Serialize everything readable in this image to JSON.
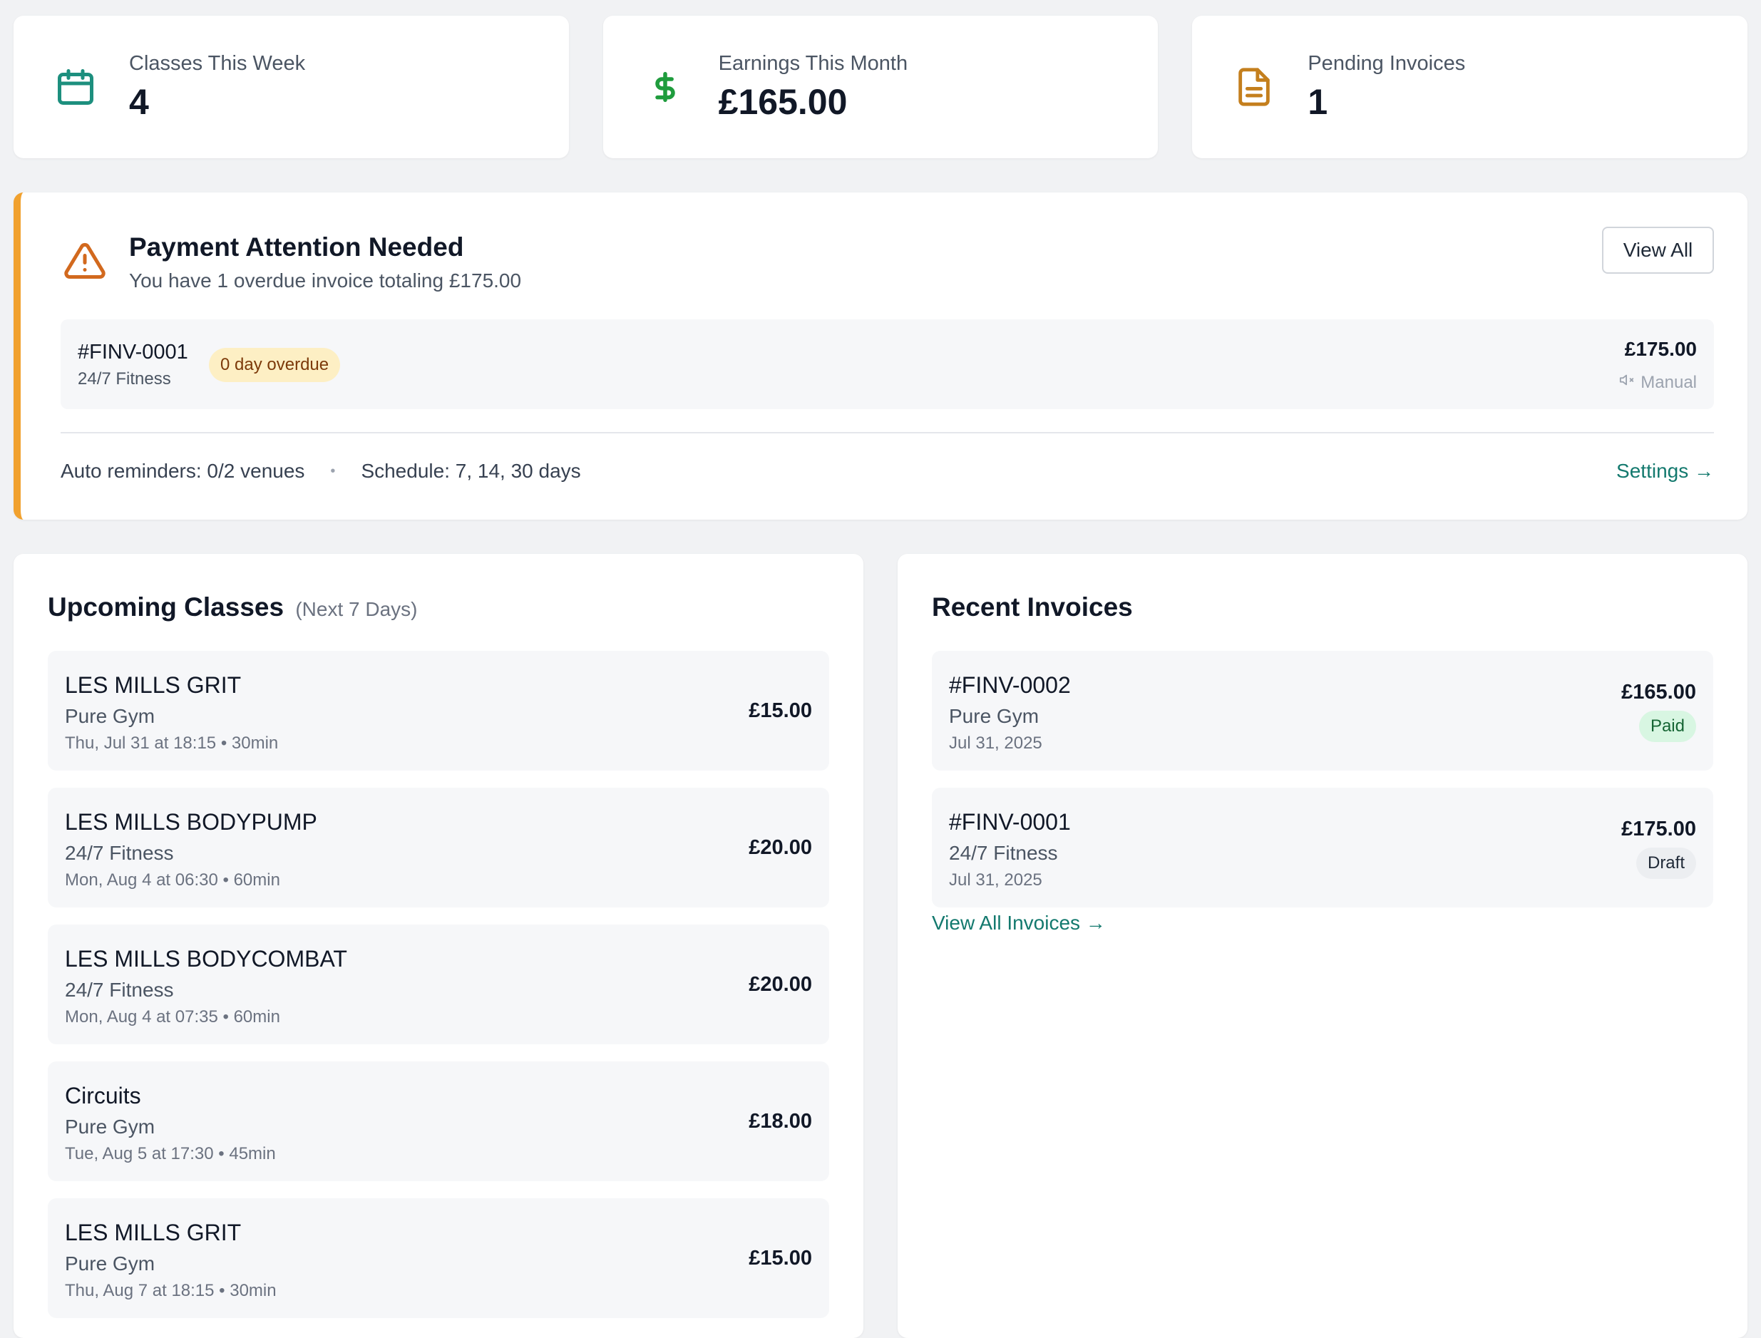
{
  "stats": [
    {
      "label": "Classes This Week",
      "value": "4",
      "icon": "calendar-icon",
      "color": "#1d8f7e"
    },
    {
      "label": "Earnings This Month",
      "value": "£165.00",
      "icon": "dollar-icon",
      "color": "#1f9c3d"
    },
    {
      "label": "Pending Invoices",
      "value": "1",
      "icon": "document-icon",
      "color": "#c47f1d"
    }
  ],
  "alert": {
    "title": "Payment Attention Needed",
    "subtitle": "You have 1 overdue invoice totaling £175.00",
    "view_all_label": "View All",
    "accent_color": "#f1a12e",
    "overdue": {
      "invoice_id": "#FINV-0001",
      "venue": "24/7 Fitness",
      "badge": "0 day overdue",
      "amount": "£175.00",
      "reminder_mode": "Manual"
    },
    "footer": {
      "auto_reminders": "Auto reminders: 0/2 venues",
      "separator": "•",
      "schedule": "Schedule: 7, 14, 30 days",
      "settings_label": "Settings →"
    }
  },
  "upcoming": {
    "title": "Upcoming Classes",
    "subtitle": "(Next 7 Days)",
    "items": [
      {
        "name": "LES MILLS GRIT",
        "venue": "Pure Gym",
        "meta": "Thu, Jul 31 at 18:15 • 30min",
        "price": "£15.00"
      },
      {
        "name": "LES MILLS BODYPUMP",
        "venue": "24/7 Fitness",
        "meta": "Mon, Aug 4 at 06:30 • 60min",
        "price": "£20.00"
      },
      {
        "name": "LES MILLS BODYCOMBAT",
        "venue": "24/7 Fitness",
        "meta": "Mon, Aug 4 at 07:35 • 60min",
        "price": "£20.00"
      },
      {
        "name": "Circuits",
        "venue": "Pure Gym",
        "meta": "Tue, Aug 5 at 17:30 • 45min",
        "price": "£18.00"
      },
      {
        "name": "LES MILLS GRIT",
        "venue": "Pure Gym",
        "meta": "Thu, Aug 7 at 18:15 • 30min",
        "price": "£15.00"
      }
    ]
  },
  "invoices": {
    "title": "Recent Invoices",
    "items": [
      {
        "id": "#FINV-0002",
        "venue": "Pure Gym",
        "date": "Jul 31, 2025",
        "amount": "£165.00",
        "status": "Paid"
      },
      {
        "id": "#FINV-0001",
        "venue": "24/7 Fitness",
        "date": "Jul 31, 2025",
        "amount": "£175.00",
        "status": "Draft"
      }
    ],
    "view_all_label": "View All Invoices →"
  }
}
